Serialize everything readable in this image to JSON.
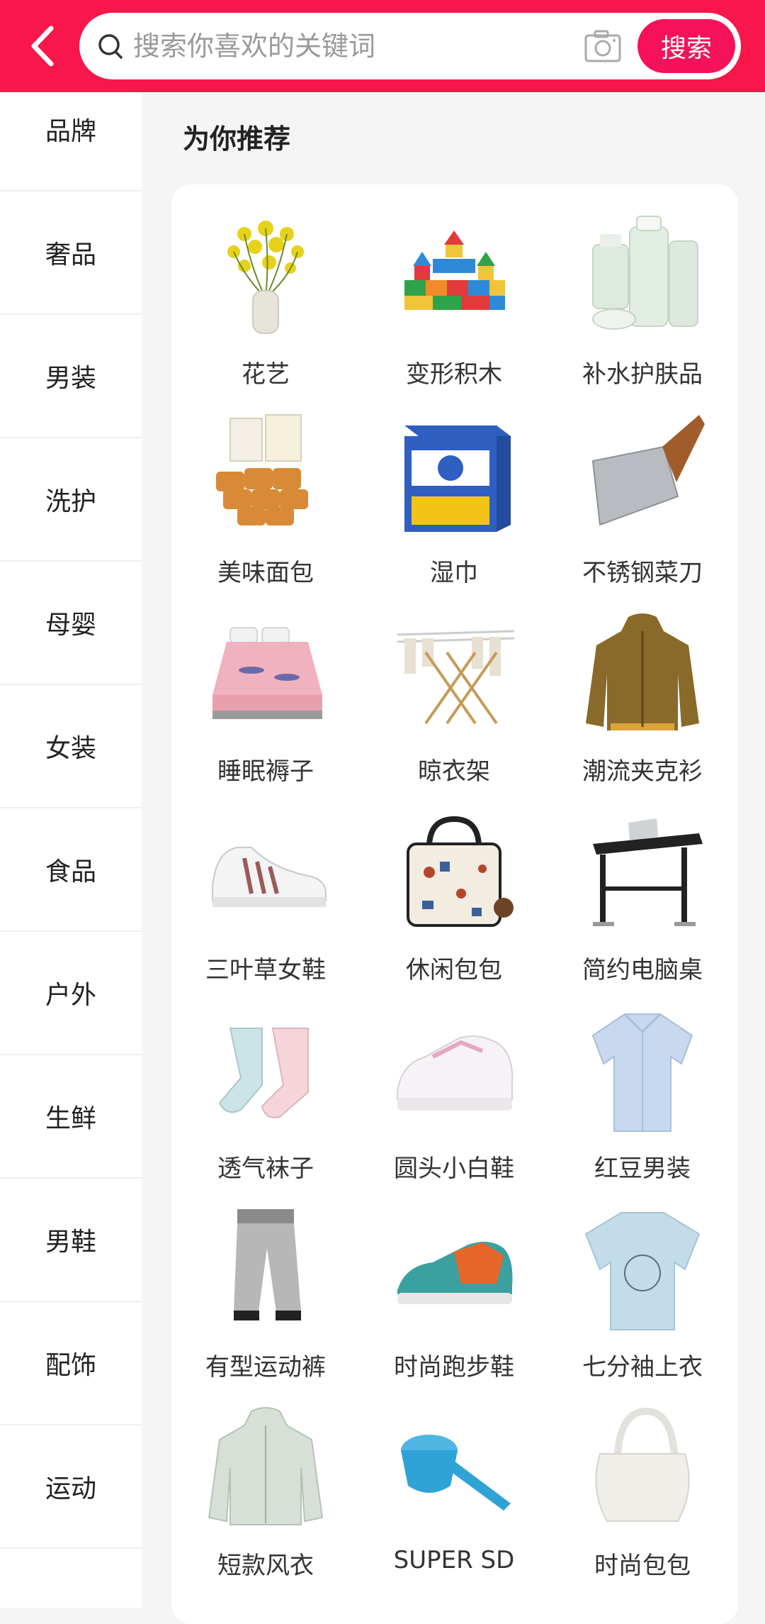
{
  "header": {
    "search_placeholder": "搜索你喜欢的关键词",
    "search_button": "搜索",
    "accent_color": "#f8174a"
  },
  "sidebar": {
    "items": [
      {
        "label": "品牌"
      },
      {
        "label": "奢品"
      },
      {
        "label": "男装"
      },
      {
        "label": "洗护"
      },
      {
        "label": "母婴"
      },
      {
        "label": "女装"
      },
      {
        "label": "食品"
      },
      {
        "label": "户外"
      },
      {
        "label": "生鲜"
      },
      {
        "label": "男鞋"
      },
      {
        "label": "配饰"
      },
      {
        "label": "运动"
      }
    ]
  },
  "main": {
    "section_title": "为你推荐",
    "products": [
      {
        "label": "花艺",
        "icon": "flower-vase-icon"
      },
      {
        "label": "变形积木",
        "icon": "building-blocks-icon"
      },
      {
        "label": "补水护肤品",
        "icon": "skincare-bottles-icon"
      },
      {
        "label": "美味面包",
        "icon": "bread-icon"
      },
      {
        "label": "湿巾",
        "icon": "wet-wipes-box-icon"
      },
      {
        "label": "不锈钢菜刀",
        "icon": "kitchen-knife-icon"
      },
      {
        "label": "睡眠褥子",
        "icon": "mattress-icon"
      },
      {
        "label": "晾衣架",
        "icon": "drying-rack-icon"
      },
      {
        "label": "潮流夹克衫",
        "icon": "jacket-icon"
      },
      {
        "label": "三叶草女鞋",
        "icon": "sneaker-icon"
      },
      {
        "label": "休闲包包",
        "icon": "handbag-icon"
      },
      {
        "label": "简约电脑桌",
        "icon": "laptop-desk-icon"
      },
      {
        "label": "透气袜子",
        "icon": "socks-icon"
      },
      {
        "label": "圆头小白鞋",
        "icon": "white-sneaker-icon"
      },
      {
        "label": "红豆男装",
        "icon": "shirt-icon"
      },
      {
        "label": "有型运动裤",
        "icon": "sweatpants-icon"
      },
      {
        "label": "时尚跑步鞋",
        "icon": "running-shoe-icon"
      },
      {
        "label": "七分袖上衣",
        "icon": "tshirt-icon"
      },
      {
        "label": "短款风衣",
        "icon": "windbreaker-icon"
      },
      {
        "label": "SUPER SD",
        "icon": "measuring-scoop-icon"
      },
      {
        "label": "时尚包包",
        "icon": "white-bag-icon"
      }
    ]
  }
}
